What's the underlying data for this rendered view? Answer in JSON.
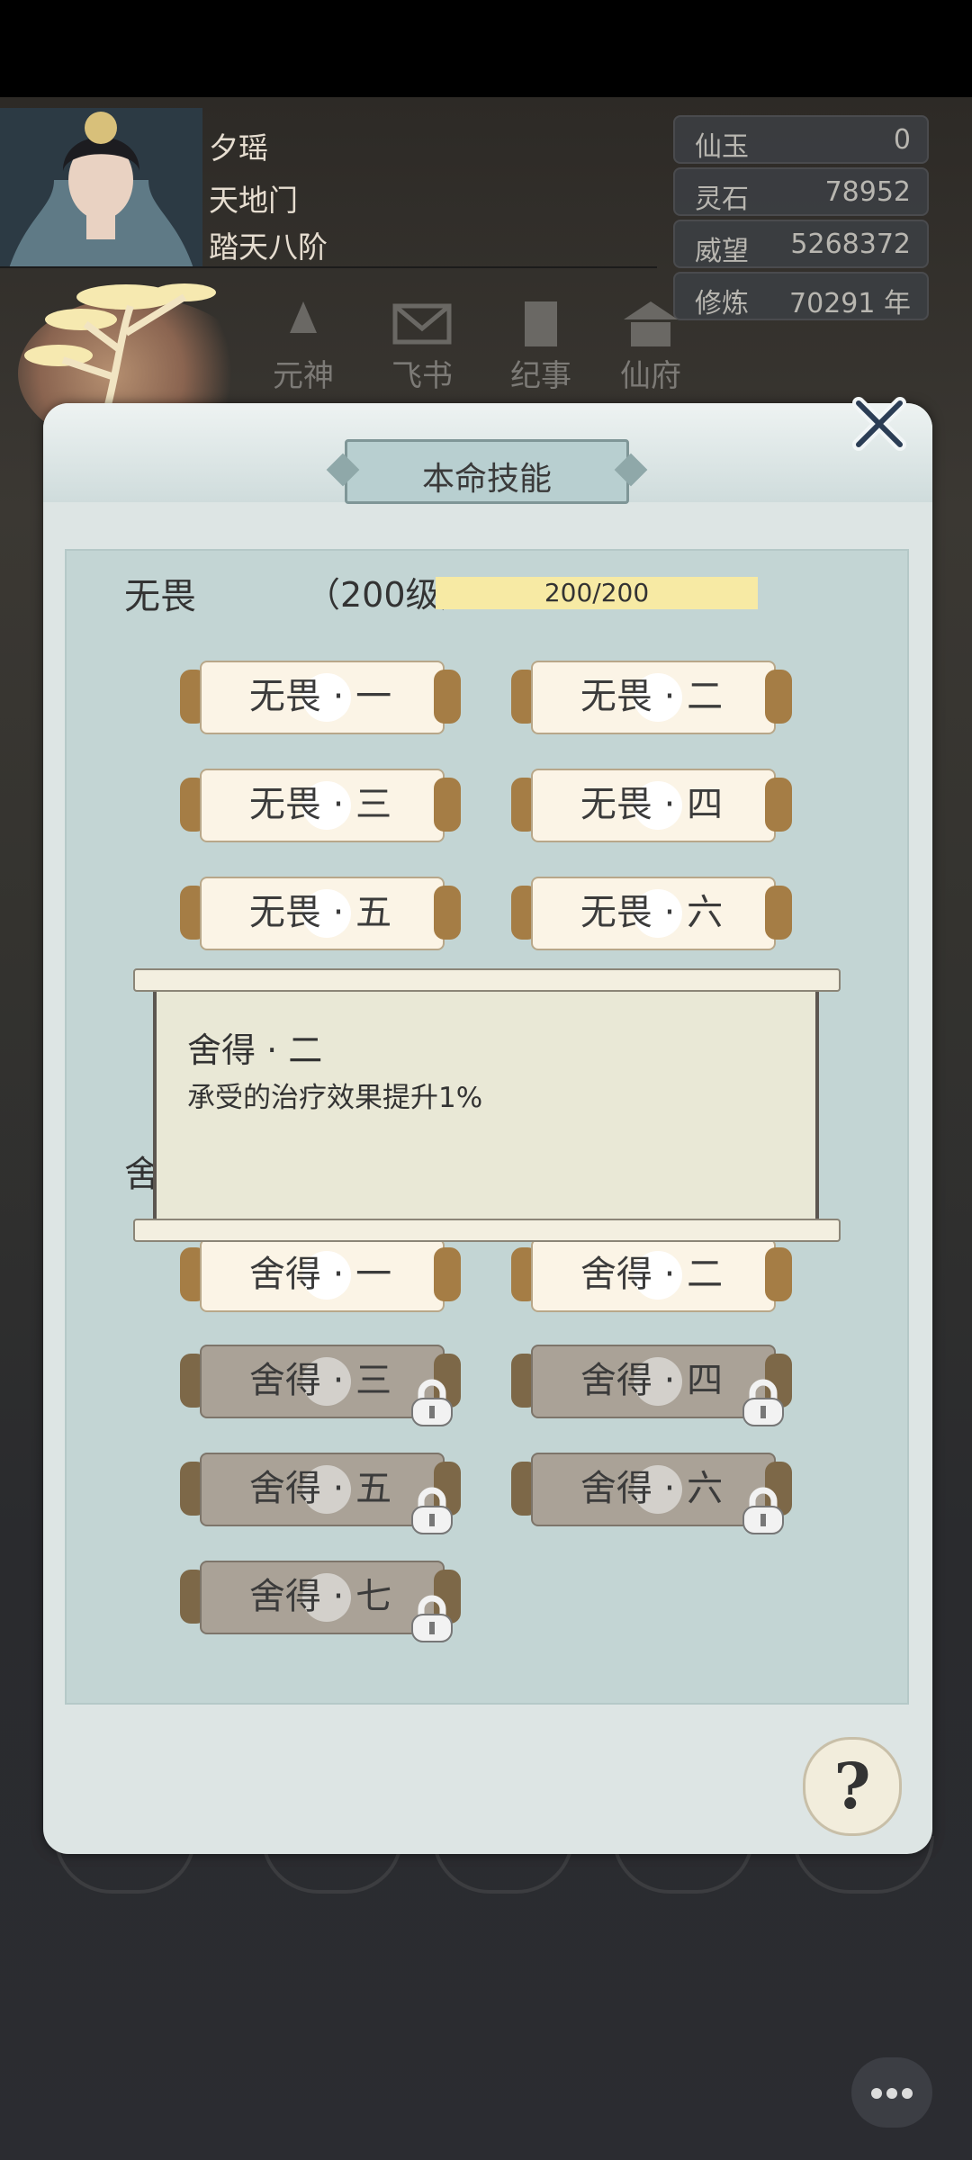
{
  "player": {
    "name": "夕瑶",
    "sect": "天地门",
    "realm": "踏天八阶"
  },
  "stats": [
    {
      "label": "仙玉",
      "value": "0"
    },
    {
      "label": "灵石",
      "value": "78952"
    },
    {
      "label": "威望",
      "value": "5268372"
    },
    {
      "label": "修炼",
      "value": "70291 年"
    }
  ],
  "nav": [
    {
      "label": "元神",
      "icon": "spirit-icon"
    },
    {
      "label": "飞书",
      "icon": "envelope-icon"
    },
    {
      "label": "纪事",
      "icon": "scroll-icon"
    },
    {
      "label": "仙府",
      "icon": "mansion-icon"
    }
  ],
  "modal": {
    "title": "本命技能",
    "skill": {
      "name": "无畏",
      "level": "（200级）",
      "progress_text": "200/200",
      "progress": 1.0
    },
    "skill_buttons": [
      {
        "label": "无畏 · 一",
        "locked": false
      },
      {
        "label": "无畏 · 二",
        "locked": false
      },
      {
        "label": "无畏 · 三",
        "locked": false
      },
      {
        "label": "无畏 · 四",
        "locked": false
      },
      {
        "label": "无畏 · 五",
        "locked": false
      },
      {
        "label": "无畏 · 六",
        "locked": false
      }
    ],
    "section2_label": "舍",
    "section2_buttons": [
      {
        "label": "舍得 · 一",
        "locked": false
      },
      {
        "label": "舍得 · 二",
        "locked": false
      },
      {
        "label": "舍得 · 三",
        "locked": true
      },
      {
        "label": "舍得 · 四",
        "locked": true
      },
      {
        "label": "舍得 · 五",
        "locked": true
      },
      {
        "label": "舍得 · 六",
        "locked": true
      },
      {
        "label": "舍得 · 七",
        "locked": true
      }
    ],
    "tooltip": {
      "title": "舍得 · 二",
      "description": "承受的治疗效果提升1%"
    },
    "help_label": "?"
  },
  "colors": {
    "progress_fill": "#f7eaa4",
    "modal_bg": "#dde5e4",
    "panel_bg": "#c3d5d4"
  }
}
